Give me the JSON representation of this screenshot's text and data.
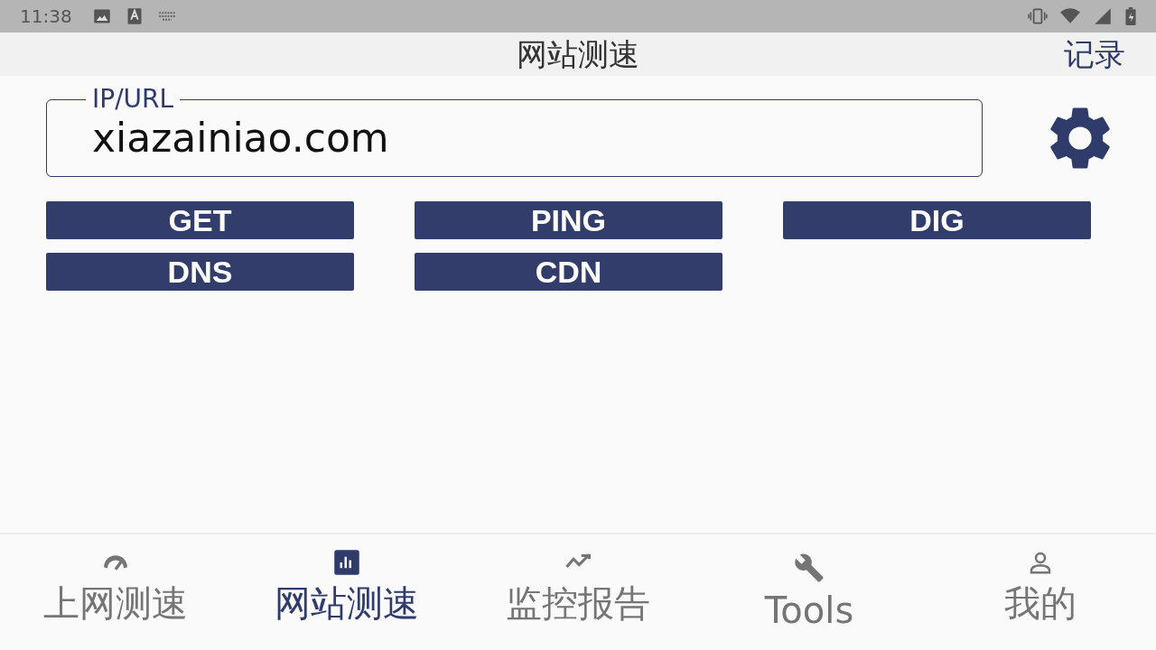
{
  "status_bar": {
    "time": "11:38"
  },
  "app_bar": {
    "title": "网站测速",
    "action": "记录"
  },
  "url_field": {
    "label": "IP/URL",
    "value": "xiazainiao.com"
  },
  "buttons": [
    "GET",
    "PING",
    "DIG",
    "DNS",
    "CDN"
  ],
  "nav": [
    {
      "label": "上网测速",
      "kind": "speed",
      "selected": false
    },
    {
      "label": "网站测速",
      "kind": "chart",
      "selected": true
    },
    {
      "label": "监控报告",
      "kind": "trend",
      "selected": false
    },
    {
      "label": "Tools",
      "kind": "wrench",
      "selected": false
    },
    {
      "label": "我的",
      "kind": "person",
      "selected": false
    }
  ]
}
